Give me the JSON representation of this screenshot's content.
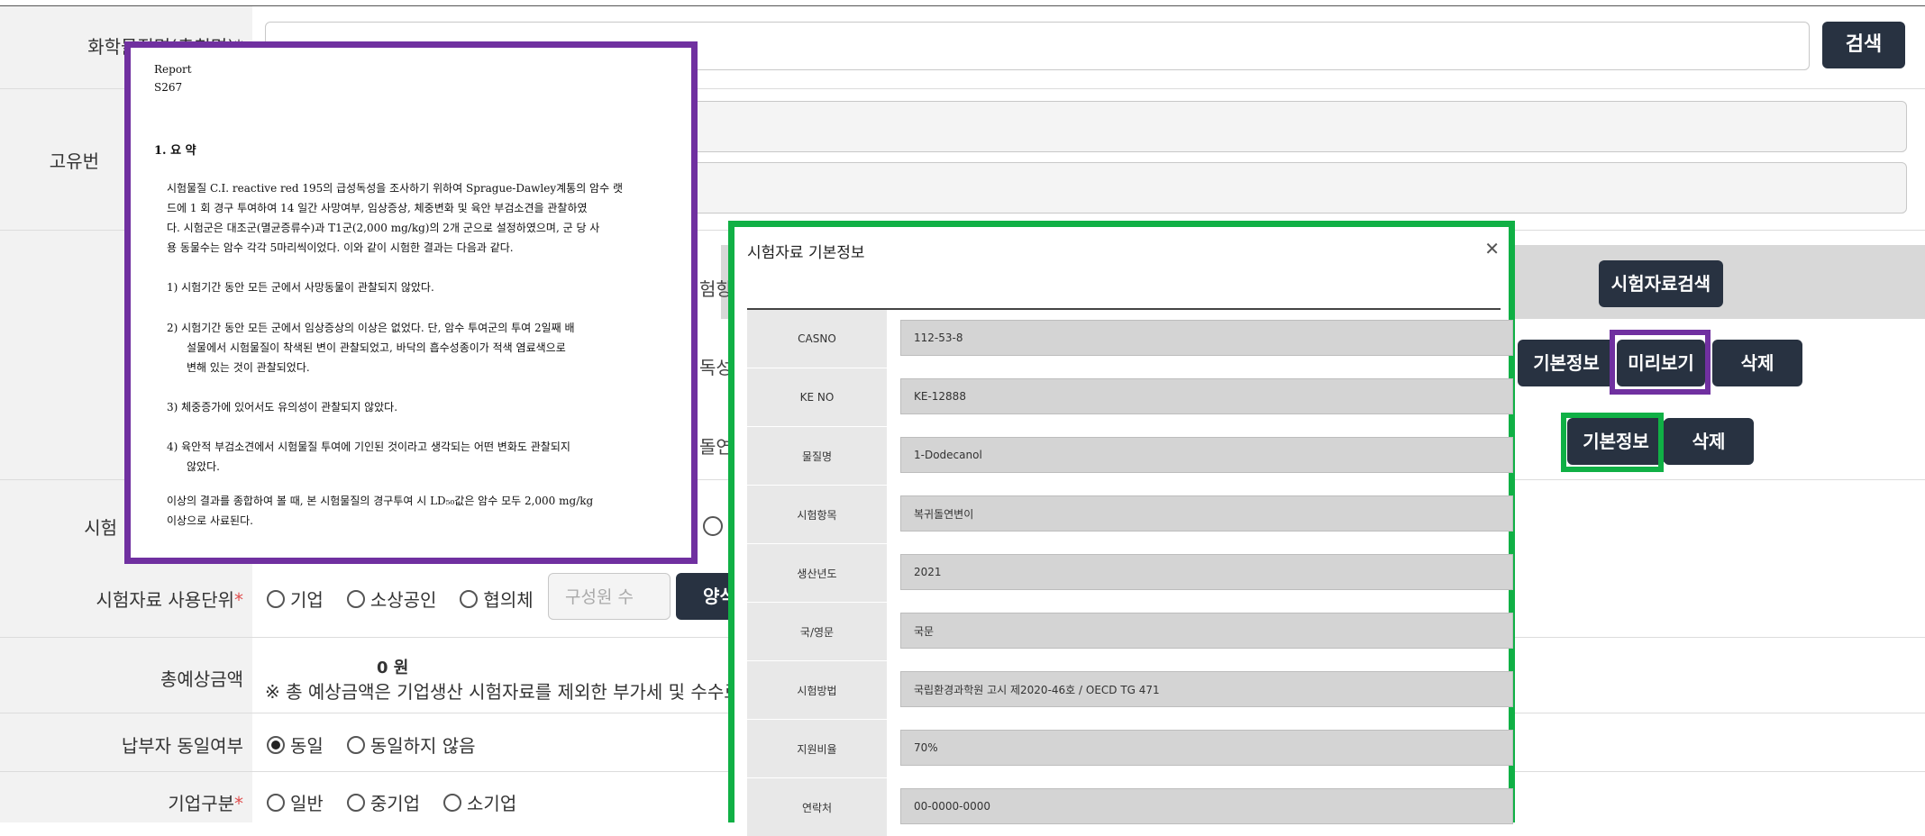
{
  "form": {
    "chem_name_label": "화학물질명(총칭명)*",
    "unique_label": "고유번",
    "test_label_partial": "시험",
    "usage_unit_label": "시험자료 사용단위",
    "usage_unit_required": "*",
    "total_cost_label": "총예상금액",
    "same_payer_label": "납부자 동일여부",
    "company_type_label": "기업구분",
    "company_type_required": "*",
    "search_button": "검색",
    "test_data_search_button": "시험자료검색",
    "basic_info_button": "기본정보",
    "preview_button": "미리보기",
    "delete_button": "삭제",
    "basic_info_button_2": "기본정보",
    "delete_button_2": "삭제",
    "col_fragment_1": "험항",
    "col_fragment_2": "독성(",
    "col_fragment_3": "돌연",
    "usage_unit_options": [
      "기업",
      "소상공인",
      "협의체"
    ],
    "member_count_placeholder": "구성원 수",
    "form_button_partial": "양식",
    "total_cost_value": "0 원",
    "total_cost_note": "※ 총 예상금액은 기업생산 시험자료를 제외한 부가세 및 수수료 포",
    "same_payer_options": [
      "동일",
      "동일하지 않음"
    ],
    "same_payer_selected": "동일",
    "company_type_options": [
      "일반",
      "중기업",
      "소기업"
    ]
  },
  "report": {
    "header_line1": "Report",
    "header_line2": "S267",
    "section_title": "1. 요 약",
    "intro_lines": [
      "시험물질 C.I. reactive red 195의 급성독성을 조사하기 위하여 Sprague-Dawley계통의 암수 랫",
      "드에 1 회 경구 투여하여 14 일간 사망여부, 임상증상, 체중변화 및 육안 부검소견을 관찰하였",
      "다. 시험군은 대조군(멸균증류수)과 T1군(2,000 mg/kg)의 2개 군으로 설정하였으며, 군 당 사",
      "용 동물수는 암수 각각 5마리씩이었다. 이와 같이 시험한 결과는 다음과 같다."
    ],
    "item1": "1)  시험기간 동안 모든 군에서 사망동물이 관찰되지 않았다.",
    "item2_lines": [
      "2)  시험기간 동안 모든 군에서 임상증상의 이상은 없었다. 단, 암수 투여군의 투여 2일째 배",
      "설물에서 시험물질이 착색된 변이 관찰되었고, 바닥의 흡수성종이가 적색 염료색으로",
      "변해 있는 것이 관찰되었다."
    ],
    "item3": "3)  체중증가에 있어서도 유의성이 관찰되지 않았다.",
    "item4_lines": [
      "4)  육안적 부검소견에서 시험물질 투여에 기인된 것이라고 생각되는 어떤 변화도 관찰되지",
      "않았다."
    ],
    "conclusion_lines": [
      "이상의 결과를 종합하여 볼 때, 본 시험물질의 경구투여 시 LD₅₀값은 암수 모두 2,000 mg/kg",
      "이상으로 사료된다."
    ]
  },
  "modal": {
    "title": "시험자료 기본정보",
    "close_icon": "close-icon",
    "fields": [
      {
        "label": "CASNO",
        "value": "112-53-8"
      },
      {
        "label": "KE NO",
        "value": "KE-12888"
      },
      {
        "label": "물질명",
        "value": "1-Dodecanol"
      },
      {
        "label": "시험항목",
        "value": "복귀돌연변이"
      },
      {
        "label": "생산년도",
        "value": "2021"
      },
      {
        "label": "국/영문",
        "value": "국문"
      },
      {
        "label": "시험방법",
        "value": "국립환경과학원 고시 제2020-46호 / OECD TG 471"
      },
      {
        "label": "지원비율",
        "value": "70%"
      },
      {
        "label": "연락처",
        "value": "00-0000-0000"
      }
    ]
  },
  "colors": {
    "highlight_purple": "#7030a0",
    "highlight_green": "#10b045",
    "dark_button": "#283241"
  }
}
